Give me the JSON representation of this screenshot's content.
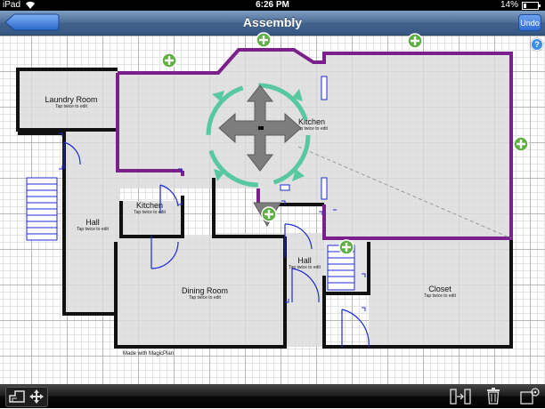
{
  "status_bar": {
    "device": "iPad",
    "time": "6:26 PM",
    "battery": "14%"
  },
  "nav": {
    "title": "Assembly",
    "back_label": "",
    "undo_label": "Undo"
  },
  "rooms": [
    {
      "name": "Laundry Room",
      "hint": "Tap twice to edit"
    },
    {
      "name": "Kitchen",
      "hint": "Tap twice to edit"
    },
    {
      "name": "Hall",
      "hint": "Tap twice to edit"
    },
    {
      "name": "Kitchen",
      "hint": "Tap twice to edit"
    },
    {
      "name": "Dining Room",
      "hint": "Tap twice to edit"
    },
    {
      "name": "Hall",
      "hint": "Tap twice to edit"
    },
    {
      "name": "Closet",
      "hint": "Tap twice to edit"
    }
  ],
  "credit": "Made with MagicPlan",
  "help_label": "?",
  "icons": {
    "add": "plus-circle-icon",
    "move": "move-arrows-icon",
    "rotate": "rotate-ring-icon",
    "help": "help-icon",
    "toolbar": [
      "floor-view-icon",
      "move-mode-icon",
      "merge-room-icon",
      "trash-icon",
      "room-settings-icon"
    ]
  },
  "colors": {
    "wall": "#111111",
    "selected_room_wall": "#7b1f8a",
    "rotate_handle": "#58c8a0",
    "add_button": "#5fb043",
    "nav_bar": "#4c6c95"
  }
}
